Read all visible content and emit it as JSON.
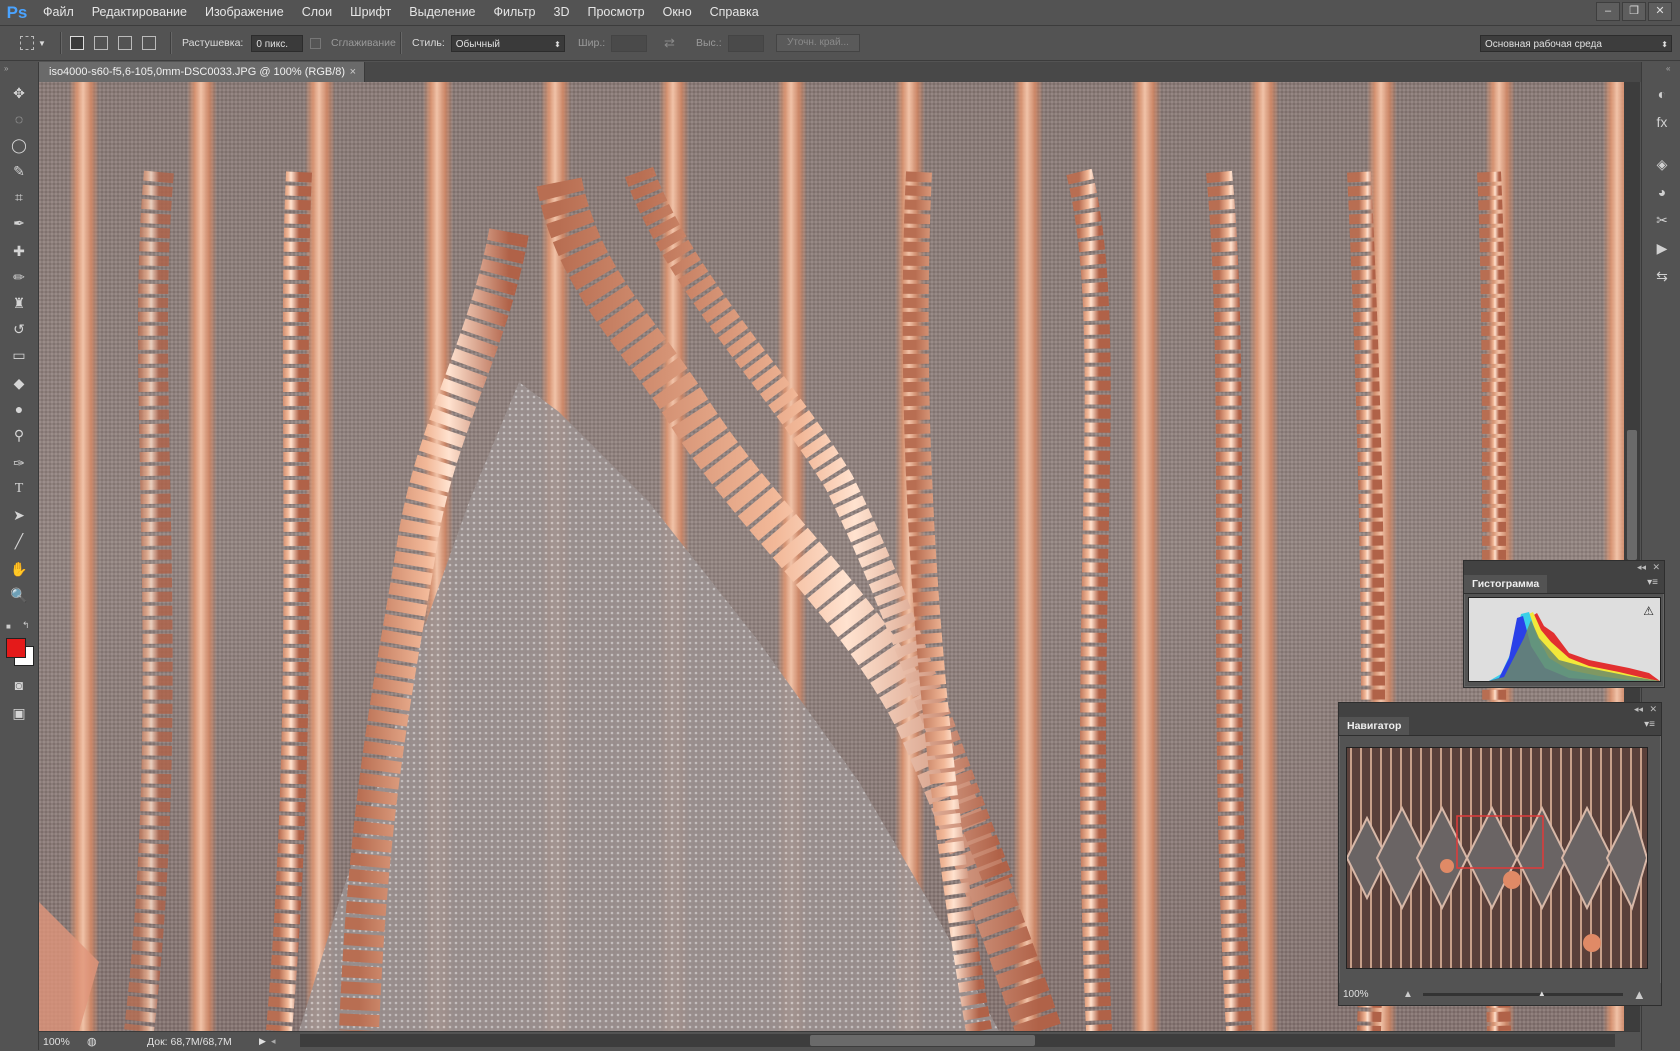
{
  "app": {
    "logo": "Ps"
  },
  "menu": [
    "Файл",
    "Редактирование",
    "Изображение",
    "Слои",
    "Шрифт",
    "Выделение",
    "Фильтр",
    "3D",
    "Просмотр",
    "Окно",
    "Справка"
  ],
  "window_controls": {
    "minimize": "–",
    "restore": "❐",
    "close": "✕"
  },
  "options": {
    "feather_label": "Растушевка:",
    "feather_value": "0 пикс.",
    "antialias_label": "Сглаживание",
    "style_label": "Стиль:",
    "style_value": "Обычный",
    "width_label": "Шир.:",
    "height_label": "Выс.:",
    "refine_edge": "Уточн. край...",
    "workspace": "Основная рабочая среда"
  },
  "document": {
    "tab_title": "iso4000-s60-f5,6-105,0mm-DSC0033.JPG @ 100% (RGB/8)",
    "close": "×"
  },
  "status": {
    "zoom": "100%",
    "doc_info": "Док: 68,7M/68,7M"
  },
  "tools": [
    "move-tool",
    "marquee-tool",
    "lasso-tool",
    "quick-select-tool",
    "crop-tool",
    "eyedropper-tool",
    "healing-tool",
    "brush-tool",
    "stamp-tool",
    "history-brush-tool",
    "eraser-tool",
    "bucket-tool",
    "blur-tool",
    "dodge-tool",
    "pen-tool",
    "type-tool",
    "path-select-tool",
    "line-tool",
    "hand-tool",
    "zoom-tool"
  ],
  "tool_glyphs": [
    "✥",
    "◌",
    "◯",
    "✎",
    "⌗",
    "✒",
    "✚",
    "✏",
    "♜",
    "↺",
    "▭",
    "◆",
    "●",
    "⚲",
    "✑",
    "T",
    "➤",
    "╱",
    "✋",
    "🔍"
  ],
  "colors": {
    "foreground": "#e41a1a",
    "background": "#ffffff",
    "accent": "#4aa3ff",
    "nav_viewbox": "#e23a3a"
  },
  "dock_icons": [
    "color-icon",
    "fx-icon",
    "layers-icon",
    "channels-icon",
    "paths-icon",
    "actions-icon",
    "history-icon"
  ],
  "dock_glyphs": [
    "◐",
    "fx",
    "◈",
    "◕",
    "✂",
    "▶",
    "⇆"
  ],
  "histogram": {
    "title": "Гистограмма",
    "warning": "⚠"
  },
  "navigator": {
    "title": "Навигатор",
    "zoom": "100%"
  }
}
